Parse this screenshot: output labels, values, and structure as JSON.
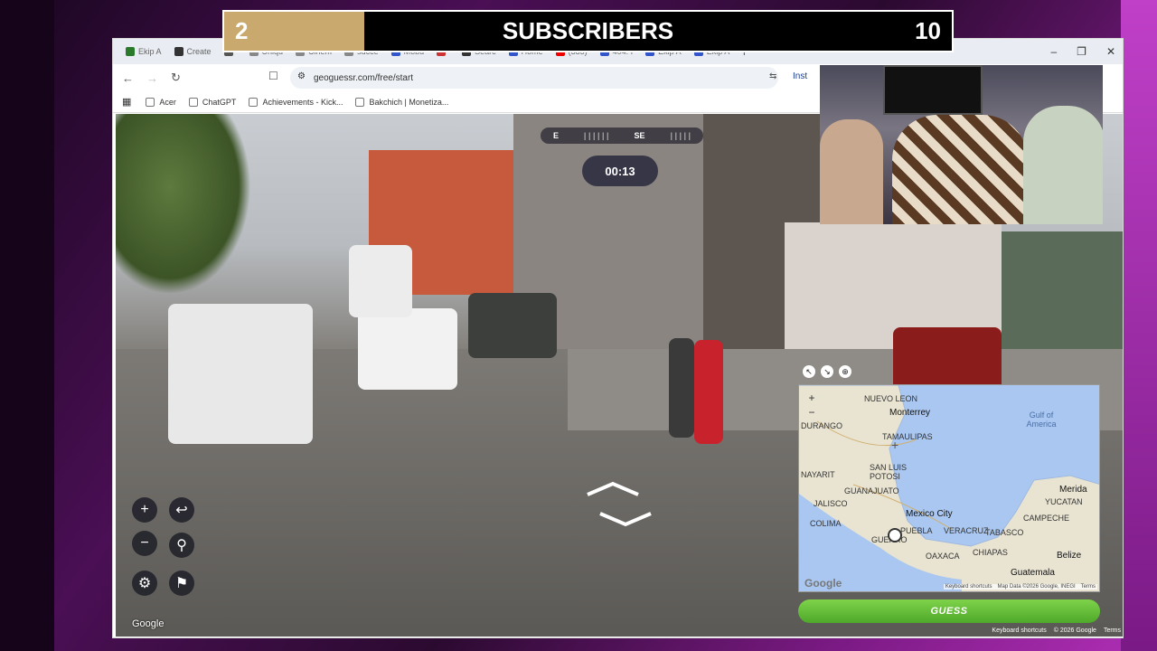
{
  "overlay": {
    "left_count": "2",
    "title": "SUBSCRIBERS",
    "right_count": "10"
  },
  "browser": {
    "tabs": [
      {
        "label": "Ekip A",
        "color": "#2b7a2b"
      },
      {
        "label": "Create",
        "color": "#333"
      },
      {
        "label": "",
        "color": "#555"
      },
      {
        "label": "Uniqu",
        "color": "#888"
      },
      {
        "label": "Cinem",
        "color": "#888"
      },
      {
        "label": "succe",
        "color": "#888"
      },
      {
        "label": "Mobu",
        "color": "#3355cc"
      },
      {
        "label": "",
        "color": "#cc3333"
      },
      {
        "label": "Searc",
        "color": "#333"
      },
      {
        "label": "Home",
        "color": "#3355cc"
      },
      {
        "label": "(385)",
        "color": "#e00"
      },
      {
        "label": "404: I",
        "color": "#3355cc"
      },
      {
        "label": "Ekip A",
        "color": "#3355cc"
      },
      {
        "label": "Ekip A",
        "color": "#3355cc"
      }
    ],
    "new_tab": "+",
    "url": "geoguessr.com/free/start",
    "install_label": "Inst",
    "bookmarks": [
      {
        "label": "Acer",
        "icon": "folder-icon"
      },
      {
        "label": "ChatGPT",
        "icon": "chatgpt-icon"
      },
      {
        "label": "Achievements - Kick...",
        "icon": "kick-icon"
      },
      {
        "label": "Bakchich | Monetiza...",
        "icon": "bakchich-icon"
      }
    ]
  },
  "game": {
    "compass_left": "E",
    "compass_heading": "SE",
    "timer": "00:13",
    "google_label": "Google",
    "controls": {
      "zoom_in": "+",
      "zoom_out": "−",
      "undo": "↩",
      "checkpoint": "⚲",
      "settings": "⚙",
      "flag": "⚑"
    }
  },
  "map": {
    "zoom_in": "+",
    "zoom_out": "−",
    "regions": [
      {
        "label": "NUEVO LEON"
      },
      {
        "label": "DURANGO"
      },
      {
        "label": "TAMAULIPAS"
      },
      {
        "label": "NAYARIT"
      },
      {
        "label": "SAN LUIS POTOSI"
      },
      {
        "label": "JALISCO"
      },
      {
        "label": "GUANAJUATO"
      },
      {
        "label": "COLIMA"
      },
      {
        "label": "PUEBLA"
      },
      {
        "label": "VERACRUZ"
      },
      {
        "label": "TABASCO"
      },
      {
        "label": "CAMPECHE"
      },
      {
        "label": "YUCATAN"
      },
      {
        "label": "OAXACA"
      },
      {
        "label": "CHIAPAS"
      },
      {
        "label": "GUERRO"
      }
    ],
    "cities": [
      "Monterrey",
      "Mexico City",
      "Merida",
      "Belize",
      "Guatemala"
    ],
    "water_label": "Gulf of America",
    "google_label": "Google",
    "attribution": [
      "Keyboard shortcuts",
      "Map Data ©2026 Google, INEGI",
      "Terms"
    ],
    "land_color": "#e9e4d2",
    "water_color": "#a9c7f0"
  },
  "guess_button": "GUESS",
  "footer": [
    "Keyboard shortcuts",
    "© 2026 Google",
    "Terms"
  ]
}
